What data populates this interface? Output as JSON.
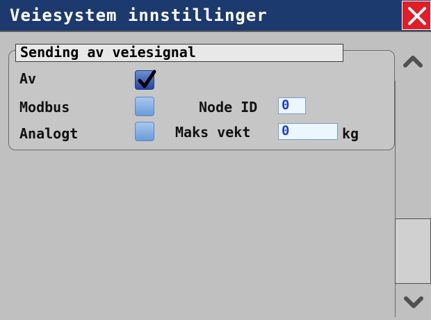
{
  "window": {
    "title": "Veiesystem innstillinger",
    "close_icon": "close-x-icon",
    "title_bg": "#1d3a6e",
    "close_bg": "#e01e2a"
  },
  "group": {
    "title": "Sending av veiesignal"
  },
  "options": [
    {
      "label": "Av",
      "checked": true
    },
    {
      "label": "Modbus",
      "checked": false
    },
    {
      "label": "Analogt",
      "checked": false
    }
  ],
  "node_id": {
    "label": "Node ID",
    "value": "0"
  },
  "max_weight": {
    "label": "Maks vekt",
    "value": "0",
    "unit": "kg"
  },
  "scrollbar": {
    "up_icon": "chevron-up-icon",
    "down_icon": "chevron-down-icon"
  }
}
